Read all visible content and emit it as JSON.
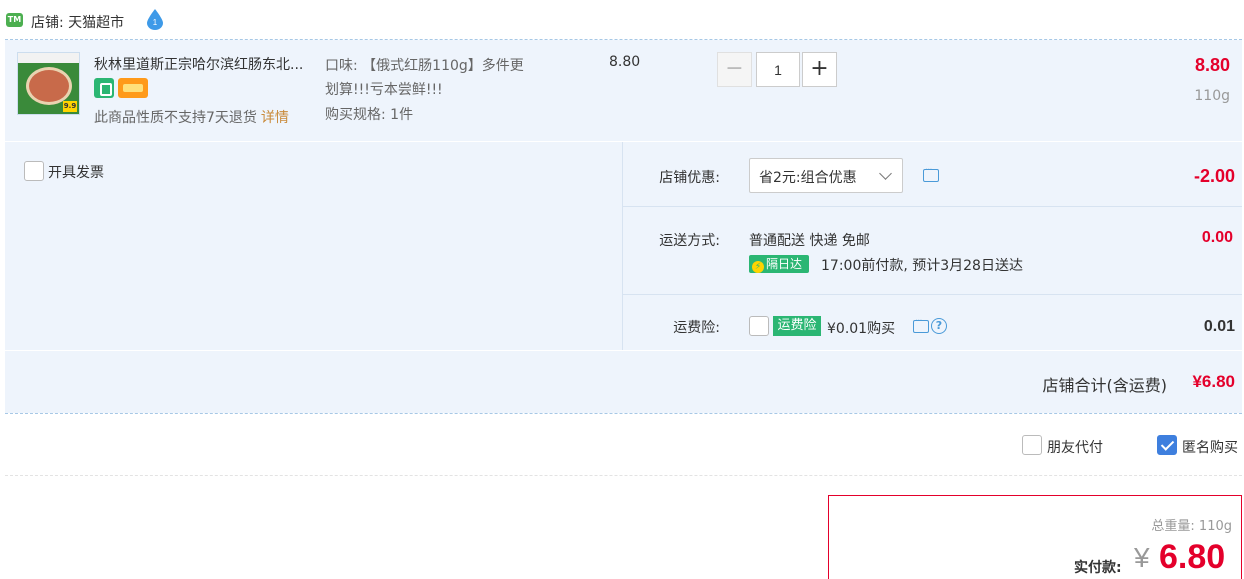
{
  "shop": {
    "label": "店铺: 天猫超市"
  },
  "item": {
    "title": "秋林里道斯正宗哈尔滨红肠东北...",
    "return_note": "此商品性质不支持7天退货",
    "return_detail": "详情",
    "flavor_line1": "口味: 【俄式红肠110g】多件更",
    "flavor_line2": "划算!!!亏本尝鲜!!!",
    "spec": "购买规格: 1件",
    "unit_price": "8.80",
    "qty_minus": "−",
    "quantity": "1",
    "qty_plus": "+",
    "total": "8.80",
    "weight": "110g",
    "thumb_tag": "9.9"
  },
  "options": {
    "invoice_label": "开具发票",
    "discount_label": "店铺优惠:",
    "discount_selected": "省2元:组合优惠",
    "discount_value": "-2.00",
    "shipping_label": "运送方式:",
    "shipping_method": "普通配送 快递 免邮",
    "shipping_badge": "隔日达",
    "shipping_time": "17:00前付款, 预计3月28日送达",
    "shipping_value": "0.00",
    "insurance_label": "运费险:",
    "insurance_badge": "运费险",
    "insurance_price": "¥0.01购买",
    "insurance_value": "0.01"
  },
  "shop_total": {
    "label": "店铺合计(含运费)",
    "value": "¥6.80"
  },
  "checkout_options": {
    "friend_pay": "朋友代付",
    "anonymous": "匿名购买",
    "anonymous_checked": true
  },
  "summary": {
    "total_weight": "总重量: 110g",
    "pay_label": "实付款:",
    "currency": "¥",
    "amount": "6.80"
  },
  "colors": {
    "accent_red": "#e4002b",
    "panel_bg": "#eef4fc",
    "green_badge": "#2bb673",
    "checkbox_blue": "#3e7fde"
  },
  "icons": [
    "shop-icon",
    "dropdown-icon",
    "chat-icon",
    "help-icon",
    "check-icon",
    "chevron-down-icon"
  ]
}
